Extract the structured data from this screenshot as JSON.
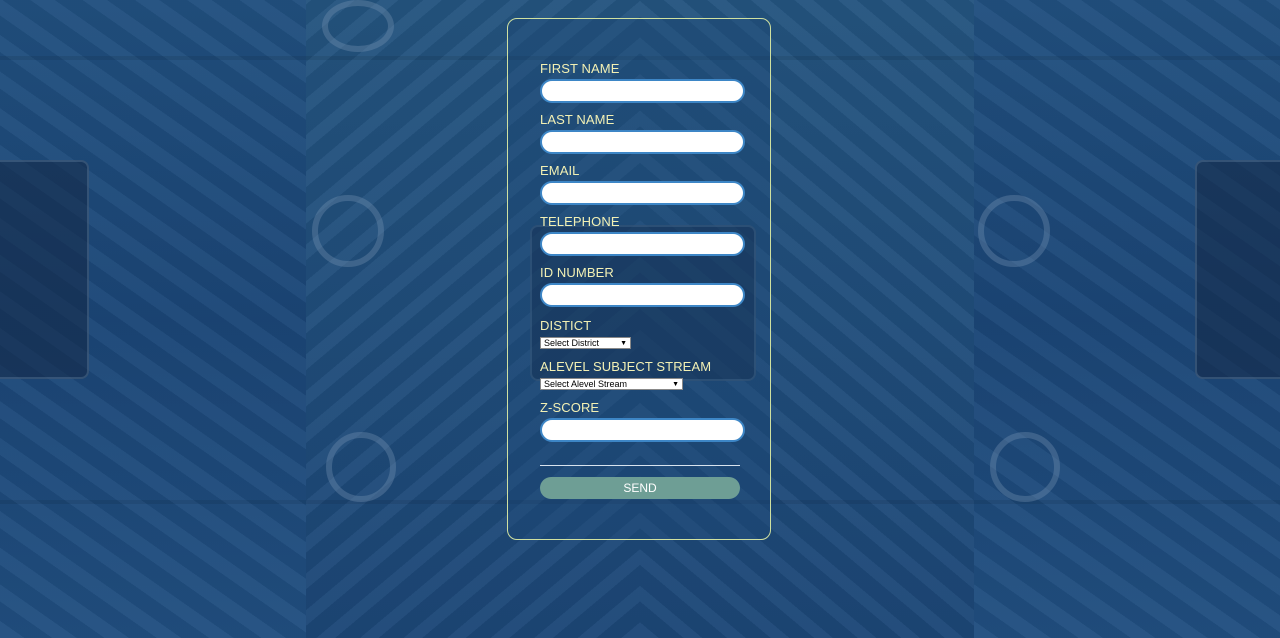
{
  "form": {
    "fields": [
      {
        "label": "FIRST NAME",
        "value": ""
      },
      {
        "label": "LAST NAME",
        "value": ""
      },
      {
        "label": "EMAIL",
        "value": ""
      },
      {
        "label": "TELEPHONE",
        "value": ""
      },
      {
        "label": "ID NUMBER",
        "value": ""
      }
    ],
    "district": {
      "label": "DISTICT",
      "selected": "Select District"
    },
    "stream": {
      "label": "ALEVEL SUBJECT STREAM",
      "selected": "Select Alevel Stream"
    },
    "zscore": {
      "label": "Z-SCORE",
      "value": ""
    },
    "send_label": "SEND"
  },
  "colors": {
    "background": "#1d4a7c",
    "label": "#f2f0b4",
    "card_border": "#cfe0a0",
    "input_border": "#3d86c6",
    "send_button": "#6e9e95"
  }
}
